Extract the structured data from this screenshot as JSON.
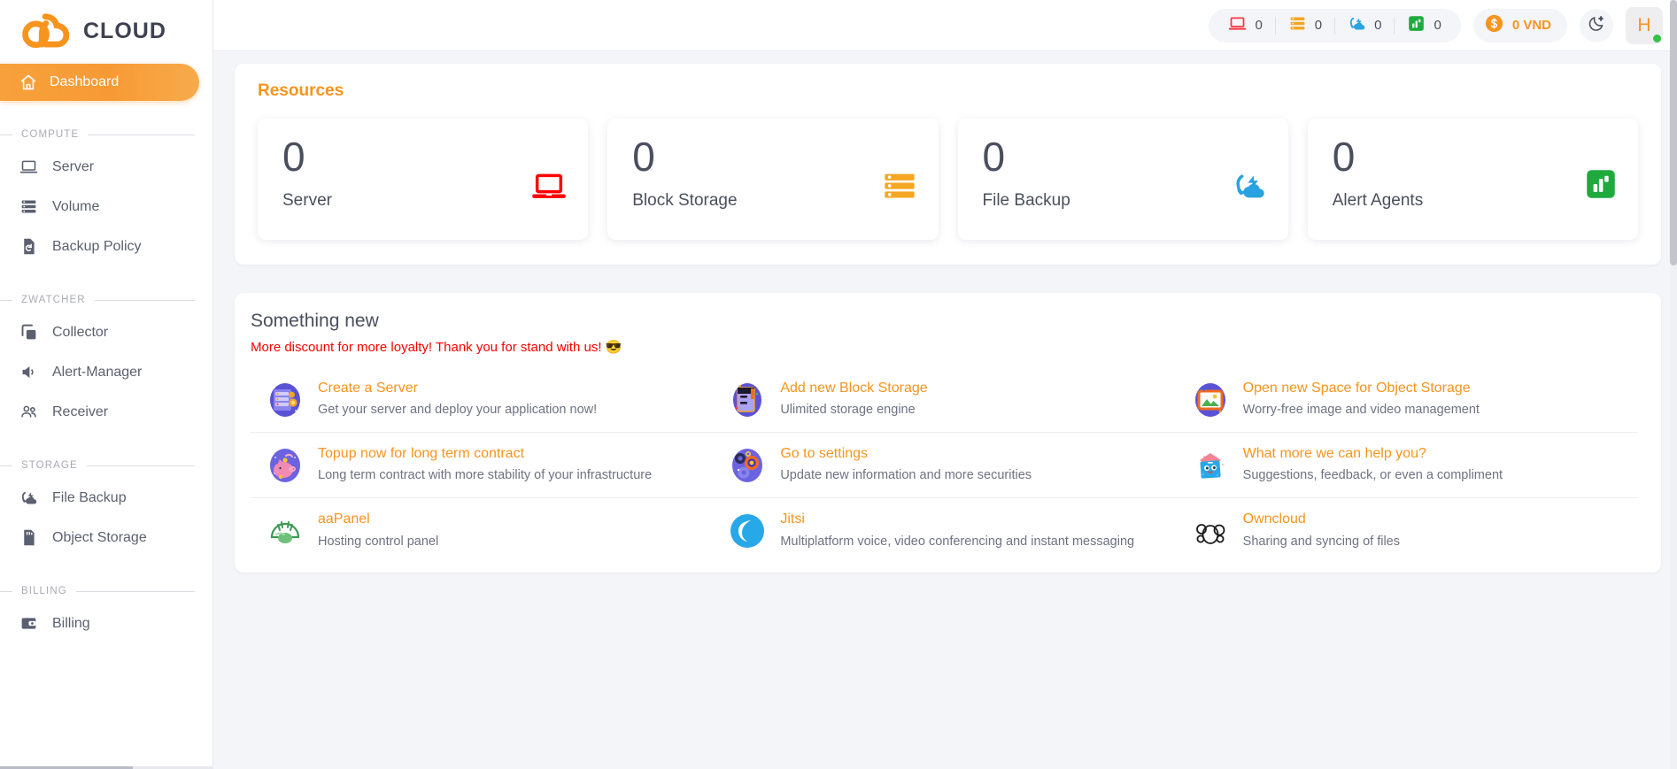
{
  "brand": {
    "name": "CLOUD",
    "logo_icon": "cloud-logo-icon"
  },
  "sidebar": {
    "active_item": {
      "label": "Dashboard",
      "icon": "home-icon"
    },
    "sections": [
      {
        "title": "COMPUTE",
        "items": [
          {
            "label": "Server",
            "icon": "laptop-icon"
          },
          {
            "label": "Volume",
            "icon": "storage-stack-icon"
          },
          {
            "label": "Backup Policy",
            "icon": "file-restore-icon"
          }
        ]
      },
      {
        "title": "ZWATCHER",
        "items": [
          {
            "label": "Collector",
            "icon": "copy-layers-icon"
          },
          {
            "label": "Alert-Manager",
            "icon": "speaker-icon"
          },
          {
            "label": "Receiver",
            "icon": "users-icon"
          }
        ]
      },
      {
        "title": "STORAGE",
        "items": [
          {
            "label": "File Backup",
            "icon": "cloud-sync-icon"
          },
          {
            "label": "Object Storage",
            "icon": "memory-card-icon"
          }
        ]
      },
      {
        "title": "BILLING",
        "items": [
          {
            "label": "Billing",
            "icon": "wallet-icon"
          }
        ]
      }
    ]
  },
  "topbar": {
    "stats": [
      {
        "icon": "laptop-icon",
        "value": "0",
        "color": "#fb3640"
      },
      {
        "icon": "storage-stack-icon",
        "value": "0",
        "color": "#f5a623"
      },
      {
        "icon": "cloud-sync-icon",
        "value": "0",
        "color": "#29a3e0"
      },
      {
        "icon": "chart-bar-icon",
        "value": "0",
        "color": "#1faa3e"
      }
    ],
    "balance": {
      "icon": "dollar-coin-icon",
      "label": "0 VND",
      "color": "#f7941d"
    },
    "theme_toggle": {
      "icon": "moon-star-icon"
    },
    "avatar": {
      "letter": "H",
      "status": "online",
      "status_color": "#35c244"
    }
  },
  "resources": {
    "title": "Resources",
    "cards": [
      {
        "value": "0",
        "label": "Server",
        "icon": "laptop-icon",
        "color": "#ff0000"
      },
      {
        "value": "0",
        "label": "Block Storage",
        "icon": "storage-stack-icon",
        "color": "#f5a623"
      },
      {
        "value": "0",
        "label": "File Backup",
        "icon": "cloud-sync-icon",
        "color": "#29a3e0"
      },
      {
        "value": "0",
        "label": "Alert Agents",
        "icon": "chart-bar-icon",
        "color": "#1faa3e"
      }
    ]
  },
  "something_new": {
    "title": "Something new",
    "promo": "More discount for more loyalty! Thank you for stand with us! 😎",
    "links": [
      [
        {
          "title": "Create a Server",
          "desc": "Get your server and deploy your application now!",
          "icon": "server-rack-art-icon"
        },
        {
          "title": "Add new Block Storage",
          "desc": "Ulimited storage engine",
          "icon": "block-storage-art-icon"
        },
        {
          "title": "Open new Space for Object Storage",
          "desc": "Worry-free image and video management",
          "icon": "image-frame-art-icon"
        }
      ],
      [
        {
          "title": "Topup now for long term contract",
          "desc": "Long term contract with more stability of your infrastructure",
          "icon": "piggy-bank-art-icon"
        },
        {
          "title": "Go to settings",
          "desc": "Update new information and more securities",
          "icon": "gears-art-icon"
        },
        {
          "title": "What more we can help you?",
          "desc": "Suggestions, feedback, or even a compliment",
          "icon": "mailbox-art-icon"
        }
      ],
      [
        {
          "title": "aaPanel",
          "desc": "Hosting control panel",
          "icon": "aapanel-logo-icon"
        },
        {
          "title": "Jitsi",
          "desc": "Multiplatform voice, video conferencing and instant messaging",
          "icon": "jitsi-logo-icon"
        },
        {
          "title": "Owncloud",
          "desc": "Sharing and syncing of files",
          "icon": "owncloud-logo-icon"
        }
      ]
    ]
  }
}
